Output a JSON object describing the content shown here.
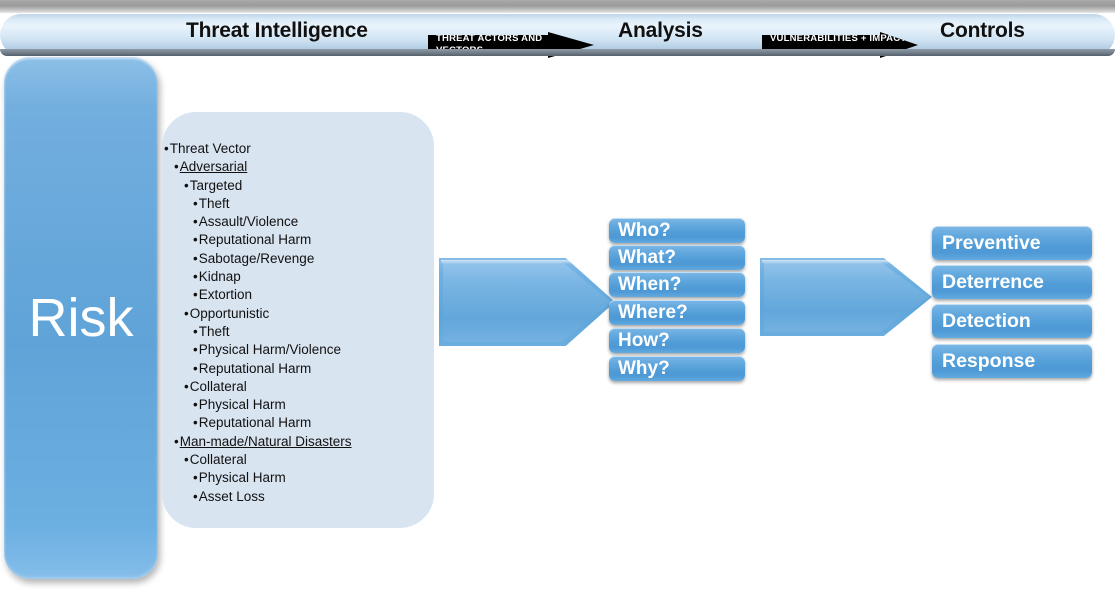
{
  "header": {
    "stages": [
      {
        "id": "threat-intelligence",
        "label": "Threat Intelligence"
      },
      {
        "id": "analysis",
        "label": "Analysis"
      },
      {
        "id": "controls",
        "label": "Controls"
      }
    ],
    "arrows": [
      {
        "id": "threat-actors-and-vectors",
        "line1": "THREAT ACTORS AND",
        "line2": "VECTORS"
      },
      {
        "id": "vulnerabilities-plus-impact",
        "line1": "VULNERABILITIES + IMPACT",
        "line2": ""
      }
    ]
  },
  "risk": {
    "label": "Risk"
  },
  "threat_list": [
    {
      "level": 0,
      "text": "Threat Vector",
      "underline": false
    },
    {
      "level": 1,
      "text": "Adversarial",
      "underline": true
    },
    {
      "level": 2,
      "text": "Targeted",
      "underline": false
    },
    {
      "level": 3,
      "text": "Theft",
      "underline": false
    },
    {
      "level": 3,
      "text": "Assault/Violence",
      "underline": false
    },
    {
      "level": 3,
      "text": "Reputational Harm",
      "underline": false
    },
    {
      "level": 3,
      "text": "Sabotage/Revenge",
      "underline": false
    },
    {
      "level": 3,
      "text": "Kidnap",
      "underline": false
    },
    {
      "level": 3,
      "text": "Extortion",
      "underline": false
    },
    {
      "level": 2,
      "text": "Opportunistic",
      "underline": false
    },
    {
      "level": 3,
      "text": "Theft",
      "underline": false
    },
    {
      "level": 3,
      "text": "Physical Harm/Violence",
      "underline": false
    },
    {
      "level": 3,
      "text": "Reputational Harm",
      "underline": false
    },
    {
      "level": 2,
      "text": "Collateral",
      "underline": false
    },
    {
      "level": 3,
      "text": "Physical Harm",
      "underline": false
    },
    {
      "level": 3,
      "text": "Reputational Harm",
      "underline": false
    },
    {
      "level": 1,
      "text": "Man-made/Natural Disasters",
      "underline": true
    },
    {
      "level": 2,
      "text": "Collateral",
      "underline": false
    },
    {
      "level": 3,
      "text": "Physical Harm",
      "underline": false
    },
    {
      "level": 3,
      "text": "Asset Loss",
      "underline": false
    }
  ],
  "bullet_glyph": "•",
  "analysis_questions": [
    {
      "id": "who",
      "label": "Who?"
    },
    {
      "id": "what",
      "label": "What?"
    },
    {
      "id": "when",
      "label": "When?"
    },
    {
      "id": "where",
      "label": "Where?"
    },
    {
      "id": "how",
      "label": "How?"
    },
    {
      "id": "why",
      "label": "Why?"
    }
  ],
  "controls": [
    {
      "id": "preventive",
      "label": "Preventive"
    },
    {
      "id": "deterrence",
      "label": "Deterrence"
    },
    {
      "id": "detection",
      "label": "Detection"
    },
    {
      "id": "response",
      "label": "Response"
    }
  ],
  "colors": {
    "banner_light": "#d9eaf7",
    "banner_dark": "#7f95a8",
    "box_blue": "#4f9bd6",
    "box_blue_light": "#7cb8e6",
    "panel_blue": "#d9e4f1",
    "risk_blue": "#5fa3d8",
    "arrow_black": "#000000",
    "text_dark": "#111111",
    "text_light": "#ffffff"
  }
}
